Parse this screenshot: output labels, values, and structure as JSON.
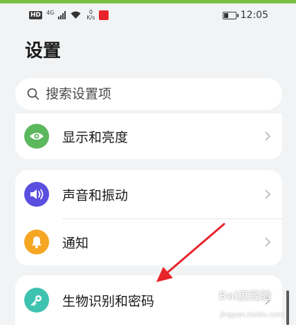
{
  "status_bar": {
    "hd": "HD",
    "signal": "4G",
    "speed_value": "0",
    "speed_unit": "K/s",
    "time": "12:05",
    "battery_level": 0.35
  },
  "header": {
    "title": "设置"
  },
  "search": {
    "placeholder": "搜索设置项"
  },
  "cards": [
    {
      "items": [
        {
          "label": "显示和亮度",
          "icon": "eye-icon",
          "color": "#5cb85c"
        }
      ]
    },
    {
      "items": [
        {
          "label": "声音和振动",
          "icon": "speaker-icon",
          "color": "#5b4fe0"
        },
        {
          "label": "通知",
          "icon": "bell-icon",
          "color": "#f5a623"
        }
      ]
    },
    {
      "items": [
        {
          "label": "生物识别和密码",
          "icon": "key-icon",
          "color": "#3fc3b1"
        }
      ]
    }
  ],
  "watermark": {
    "text": "Bai度经验",
    "url": "jingyan.baidu.com"
  },
  "colors": {
    "accent_top": "#7ac142",
    "annotation_arrow": "#e8232a"
  }
}
